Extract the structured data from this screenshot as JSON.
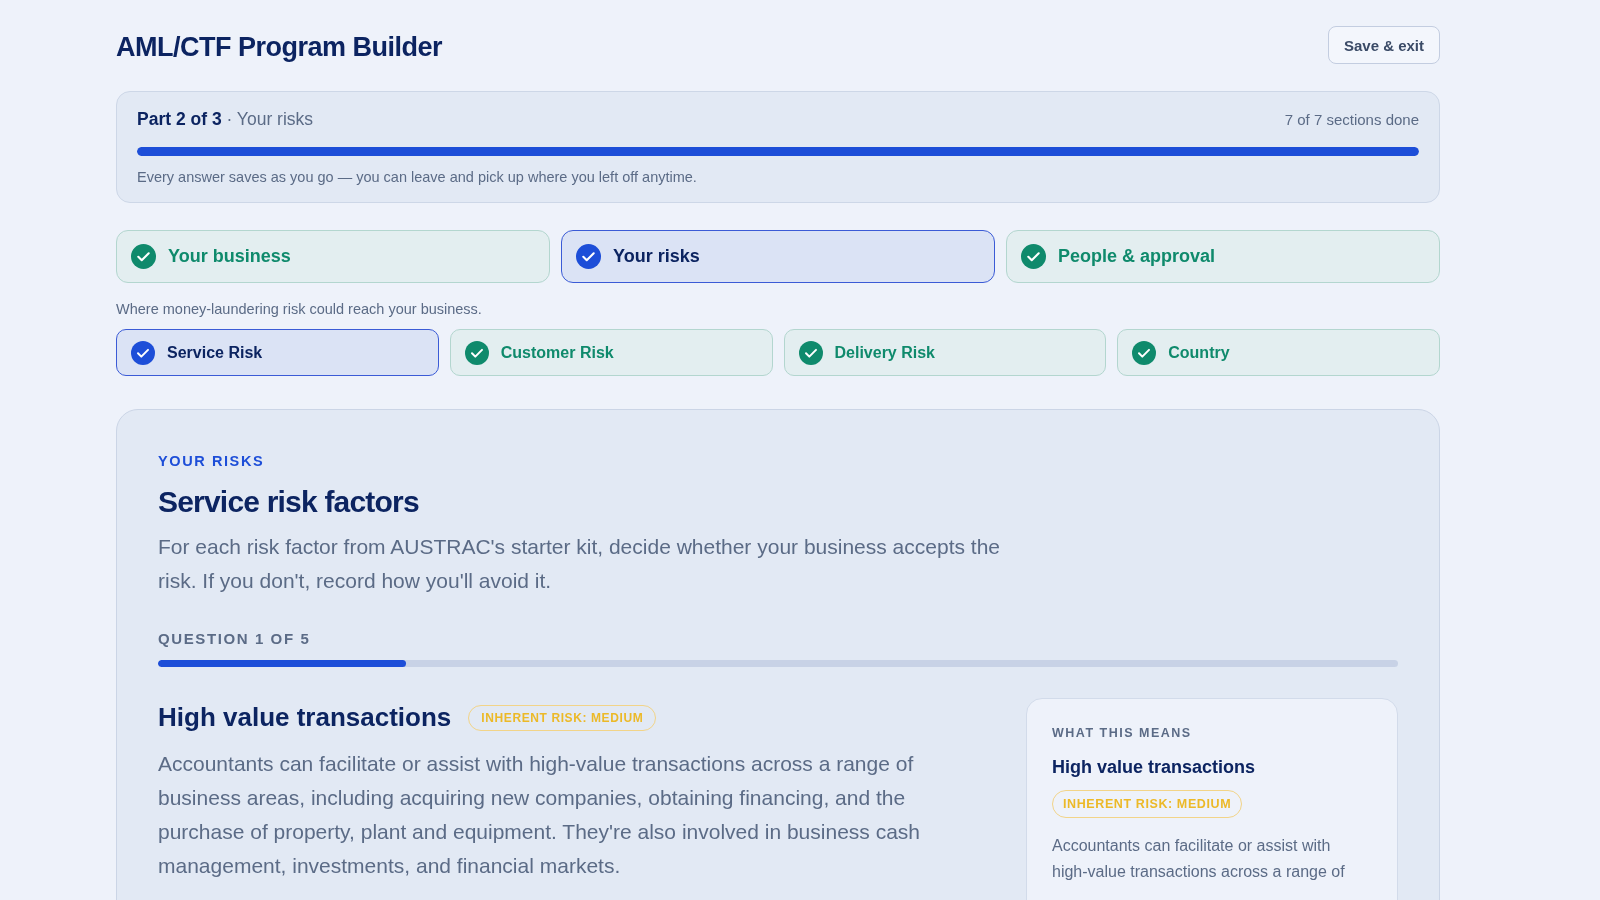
{
  "header": {
    "title": "AML/CTF Program Builder",
    "save_button": "Save & exit"
  },
  "progress": {
    "part": "**Part 2 of 3** · Your risks",
    "sections_done": "7 of 7 sections done",
    "level": 1,
    "note": "Every answer saves as you go — you can leave and pick up where you left off anytime."
  },
  "parts": [
    {
      "label": "Your business",
      "done": true,
      "selected": false
    },
    {
      "label": "Your risks",
      "done": true,
      "selected": true
    },
    {
      "label": "People & approval",
      "done": true,
      "selected": false
    }
  ],
  "parts_hint": "Where money-laundering risk could reach your business.",
  "sections": [
    {
      "label": "Service Risk",
      "done": true,
      "selected": true
    },
    {
      "label": "Customer Risk",
      "done": true,
      "selected": false
    },
    {
      "label": "Delivery Risk",
      "done": true,
      "selected": false
    },
    {
      "label": "Country",
      "done": true,
      "selected": false
    }
  ],
  "card": {
    "eyebrow": "YOUR RISKS",
    "title": "Service risk factors",
    "description": "For each risk factor from AUSTRAC's starter kit, decide whether your business accepts the risk. If you don't, record how you'll avoid it.",
    "question_counter": "QUESTION 1 OF 5",
    "level": 0.2,
    "question": {
      "title": "High value transactions",
      "badge": "INHERENT RISK: MEDIUM",
      "text": "Accountants can facilitate or assist with high-value transactions across a range of business areas, including acquiring new companies, obtaining financing, and the purchase of property, plant and equipment. They're also involved in business cash management, investments, and financial markets."
    },
    "explainer": {
      "eyebrow": "WHAT THIS MEANS",
      "title": "High value transactions",
      "badge": "INHERENT RISK: MEDIUM",
      "text": "Accountants can facilitate or assist with high-value transactions across a range of"
    }
  }
}
